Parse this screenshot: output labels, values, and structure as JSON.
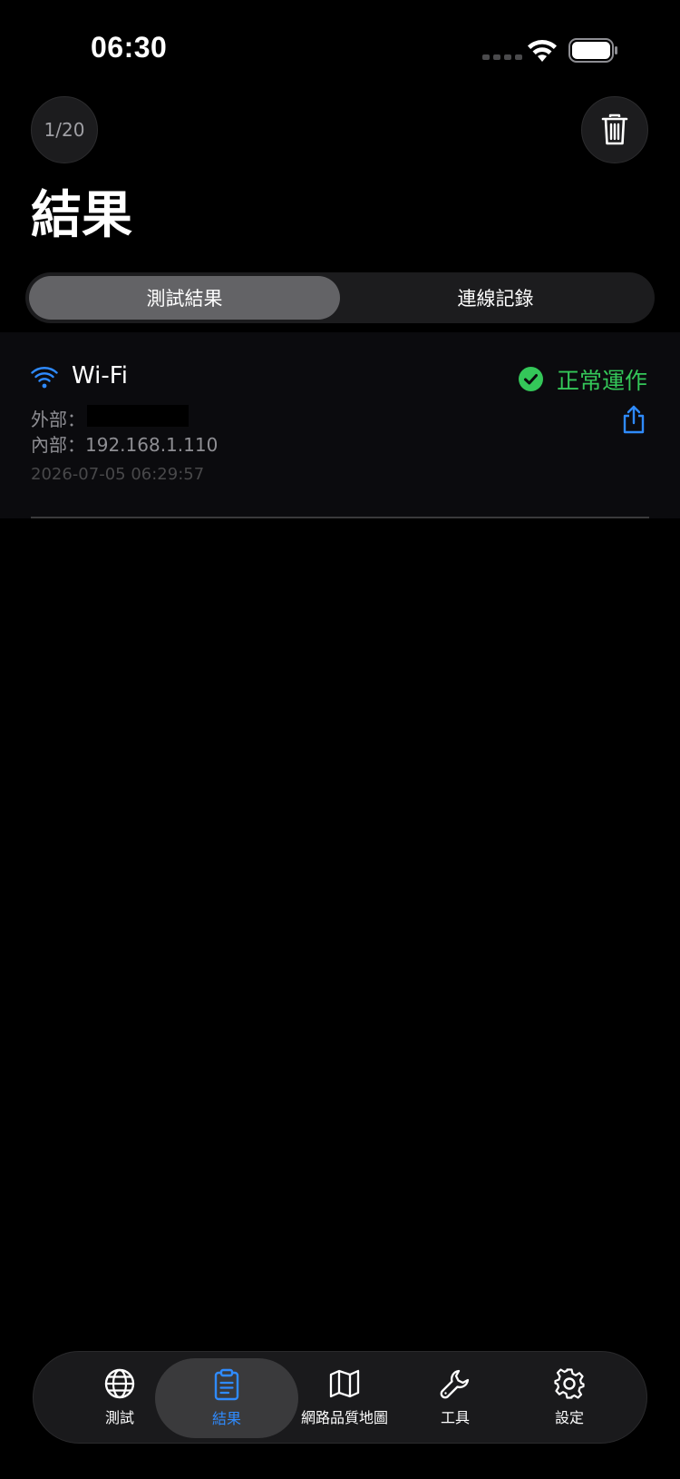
{
  "status_bar": {
    "time": "06:30"
  },
  "header": {
    "counter": "1/20",
    "title": "結果"
  },
  "segments": [
    {
      "label": "測試結果",
      "active": true
    },
    {
      "label": "連線記錄",
      "active": false
    }
  ],
  "result": {
    "type": "Wi-Fi",
    "status": "正常運作",
    "external_label": "外部：",
    "internal_label": "內部：192.168.1.110",
    "timestamp": "2026-07-05 06:29:57"
  },
  "tab_bar": {
    "items": [
      {
        "label": "測試",
        "icon": "globe-icon",
        "selected": false
      },
      {
        "label": "結果",
        "icon": "clipboard-icon",
        "selected": true
      },
      {
        "label": "網路品質地圖",
        "icon": "map-icon",
        "selected": false
      },
      {
        "label": "工具",
        "icon": "wrench-icon",
        "selected": false
      },
      {
        "label": "設定",
        "icon": "gear-icon",
        "selected": false
      }
    ]
  },
  "colors": {
    "accent": "#2f8bff",
    "success": "#34c759",
    "background": "#000000"
  }
}
